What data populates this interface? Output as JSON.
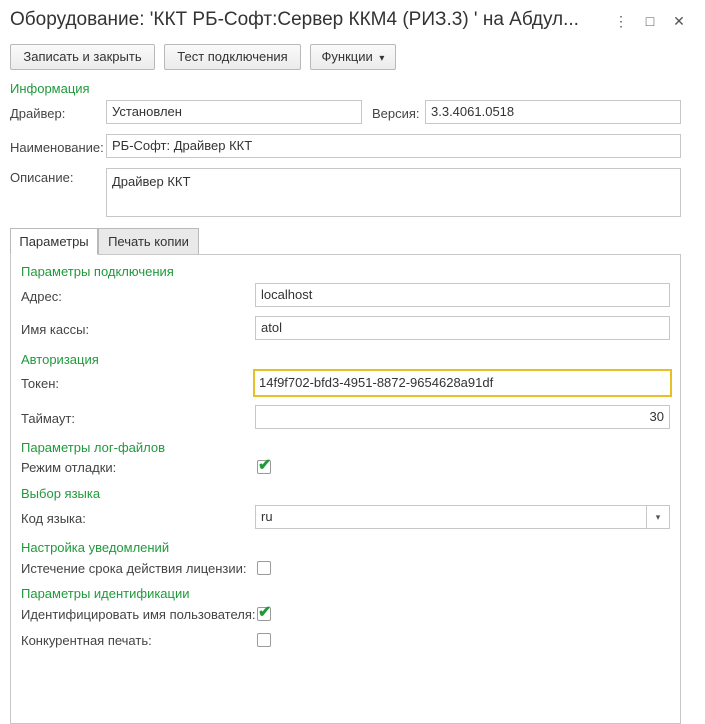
{
  "window": {
    "title": "Оборудование: 'ККТ РБ-Софт:Сервер ККМ4 (РИЗ.3) ' на Абдул...",
    "more_icon": "⋮",
    "maximize_icon": "□",
    "close_icon": "✕"
  },
  "toolbar": {
    "save_close": "Записать и закрыть",
    "test_connection": "Тест подключения",
    "functions": "Функции",
    "dropdown_icon": "▾"
  },
  "info": {
    "section": "Информация",
    "driver_label": "Драйвер:",
    "driver_value": "Установлен",
    "version_label": "Версия:",
    "version_value": "3.3.4061.0518",
    "name_label": "Наименование:",
    "name_value": "РБ-Софт: Драйвер ККТ",
    "description_label": "Описание:",
    "description_value": "Драйвер ККТ"
  },
  "tabs": [
    {
      "label": "Параметры",
      "active": true
    },
    {
      "label": "Печать копии",
      "active": false
    }
  ],
  "params": {
    "connection_section": "Параметры подключения",
    "address_label": "Адрес:",
    "address_value": "localhost",
    "cashbox_label": "Имя кассы:",
    "cashbox_value": "atol",
    "auth_section": "Авторизация",
    "token_label": "Токен:",
    "token_value": "14f9f702-bfd3-4951-8872-9654628a91df",
    "timeout_label": "Таймаут:",
    "timeout_value": "30",
    "log_section": "Параметры лог-файлов",
    "debug_label": "Режим отладки:",
    "debug_checked": true,
    "lang_section": "Выбор языка",
    "lang_label": "Код языка:",
    "lang_value": "ru",
    "notify_section": "Настройка уведомлений",
    "license_label": "Истечение срока действия лицензии:",
    "license_checked": false,
    "ident_section": "Параметры идентификации",
    "ident_user_label": "Идентифицировать имя пользователя:",
    "ident_user_checked": true,
    "concurrent_label": "Конкурентная печать:",
    "concurrent_checked": false,
    "check_glyph": "✔"
  },
  "colors": {
    "section_green": "#1f9a3b",
    "focus_border": "#e7c023"
  }
}
